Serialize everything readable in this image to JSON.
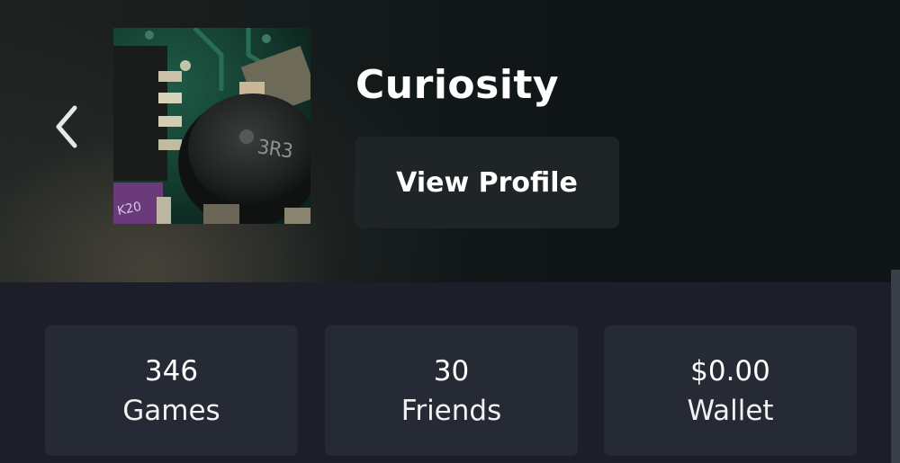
{
  "profile": {
    "username": "Curiosity",
    "view_profile_label": "View Profile"
  },
  "nav": {
    "back_icon": "chevron-left-icon"
  },
  "stats": [
    {
      "value": "346",
      "label": "Games"
    },
    {
      "value": "30",
      "label": "Friends"
    },
    {
      "value": "$0.00",
      "label": "Wallet"
    }
  ],
  "colors": {
    "background": "#1c1f27",
    "card": "#252a34",
    "button": "#1f2426",
    "text": "#ffffff"
  }
}
